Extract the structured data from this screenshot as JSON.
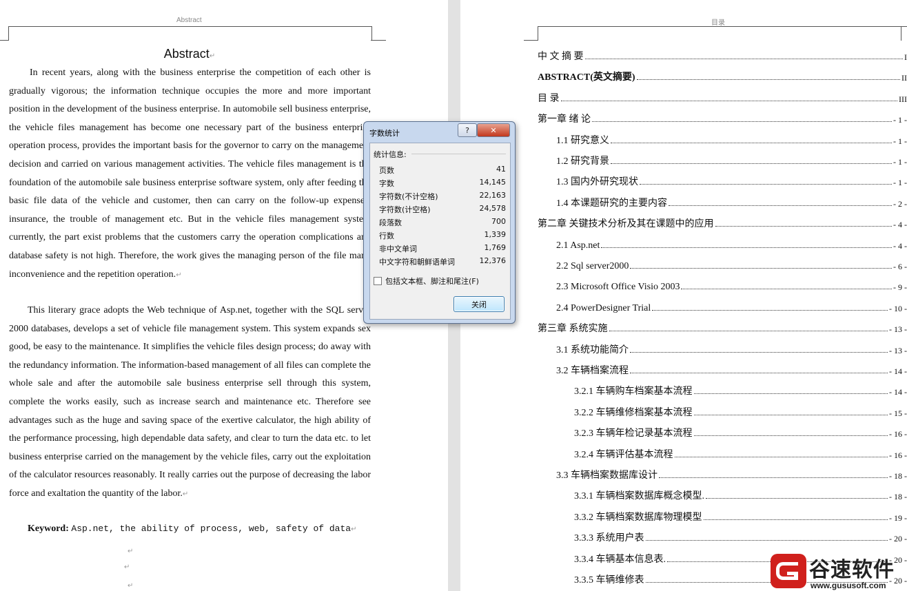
{
  "left_page": {
    "header": "Abstract",
    "title": "Abstract",
    "paragraph1": "In recent years, along with the business enterprise the competition of each other is gradually vigorous; the information technique occupies the more and more important position in the development of the business enterprise. In automobile sell business enterprise, the vehicle files management has become one necessary part of the business enterprise operation process, provides the important basis for the governor to carry on the management decision and carried on various management activities. The vehicle files management is the foundation of the automobile sale business enterprise software system, only after feeding the basic file data of the vehicle and customer, then can carry on the follow-up expenses, insurance, the trouble of management etc. But in the vehicle files management system currently, the part exist problems that the customers carry the operation complications and database safety is not high. Therefore, the work gives the managing person of the file many inconvenience and the repetition operation.",
    "paragraph2": "This literary grace adopts the Web technique of Asp.net, together with the SQL server 2000 databases, develops a set of vehicle file management system. This system expands sex good, be easy to the maintenance. It simplifies the vehicle files design process; do away with the redundancy information. The information-based management of all files can complete the whole sale and after the automobile sale business enterprise sell through this system, complete the works easily, such as increase search and maintenance etc. Therefore see advantages such as the huge and saving space of the exertive calculator, the high ability of the performance processing, high dependable data safety, and clear to turn the data etc. to let business enterprise carried on the management by the vehicle files, carry out the exploitation of the calculator resources reasonably. It really carries out the purpose of decreasing the labor force and exaltation the quantity of the labor.",
    "keyword_label": "Keyword:",
    "keyword_value": "Asp.net, the ability of process, web, safety of data",
    "para_mark": "↵"
  },
  "right_page": {
    "header": "目录",
    "toc": [
      {
        "text": "中  文  摘  要",
        "page": "I",
        "indent": 0,
        "bold": false
      },
      {
        "text": "ABSTRACT(英文摘要)",
        "page": "II",
        "indent": 0,
        "bold": true
      },
      {
        "text": "目        录",
        "page": "III",
        "indent": 0,
        "bold": false
      },
      {
        "text": "第一章   绪   论",
        "page": "- 1 -",
        "indent": 0,
        "bold": false
      },
      {
        "text": "1.1 研究意义",
        "page": "- 1 -",
        "indent": 1,
        "bold": false
      },
      {
        "text": "1.2 研究背景",
        "page": "- 1 -",
        "indent": 1,
        "bold": false
      },
      {
        "text": "1.3 国内外研究现状",
        "page": "- 1 -",
        "indent": 1,
        "bold": false
      },
      {
        "text": "1.4 本课题研究的主要内容",
        "page": "- 2 -",
        "indent": 1,
        "bold": false
      },
      {
        "text": "第二章  关键技术分析及其在课题中的应用",
        "page": "- 4 -",
        "indent": 0,
        "bold": false
      },
      {
        "text": "2.1  Asp.net",
        "page": "- 4 -",
        "indent": 1,
        "bold": false
      },
      {
        "text": "2.2  Sql server2000",
        "page": "- 6 -",
        "indent": 1,
        "bold": false
      },
      {
        "text": "2.3  Microsoft Office Visio  2003",
        "page": "- 9 -",
        "indent": 1,
        "bold": false
      },
      {
        "text": "2.4  PowerDesigner Trial",
        "page": "- 10 -",
        "indent": 1,
        "bold": false
      },
      {
        "text": "第三章   系统实施",
        "page": "- 13 -",
        "indent": 0,
        "bold": false
      },
      {
        "text": "3.1 系统功能简介",
        "page": "- 13 -",
        "indent": 1,
        "bold": false
      },
      {
        "text": "3.2 车辆档案流程",
        "page": "- 14 -",
        "indent": 1,
        "bold": false
      },
      {
        "text": "3.2.1 车辆购车档案基本流程",
        "page": "- 14 -",
        "indent": 2,
        "bold": false
      },
      {
        "text": "3.2.2 车辆维修档案基本流程",
        "page": "- 15 -",
        "indent": 2,
        "bold": false
      },
      {
        "text": "3.2.3 车辆年检记录基本流程",
        "page": "- 16 -",
        "indent": 2,
        "bold": false
      },
      {
        "text": "3.2.4 车辆评估基本流程",
        "page": "- 16 -",
        "indent": 2,
        "bold": false
      },
      {
        "text": "3.3 车辆档案数据库设计",
        "page": "- 18 -",
        "indent": 1,
        "bold": false
      },
      {
        "text": "3.3.1 车辆档案数据库概念模型.",
        "page": "- 18 -",
        "indent": 2,
        "bold": false
      },
      {
        "text": "3.3.2 车辆档案数据库物理模型",
        "page": "- 19 -",
        "indent": 2,
        "bold": false
      },
      {
        "text": "3.3.3 系统用户表",
        "page": "- 20 -",
        "indent": 2,
        "bold": false
      },
      {
        "text": "3.3.4 车辆基本信息表.",
        "page": "- 20 -",
        "indent": 2,
        "bold": false
      },
      {
        "text": "3.3.5 车辆维修表",
        "page": "- 20 -",
        "indent": 2,
        "bold": false
      }
    ]
  },
  "dialog": {
    "title": "字数统计",
    "help_label": "?",
    "close_x_label": "✕",
    "section_label": "统计信息:",
    "stats": [
      {
        "label": "页数",
        "value": "41"
      },
      {
        "label": "字数",
        "value": "14,145"
      },
      {
        "label": "字符数(不计空格)",
        "value": "22,163"
      },
      {
        "label": "字符数(计空格)",
        "value": "24,578"
      },
      {
        "label": "段落数",
        "value": "700"
      },
      {
        "label": "行数",
        "value": "1,339"
      },
      {
        "label": "非中文单词",
        "value": "1,769"
      },
      {
        "label": "中文字符和朝鲜语单词",
        "value": "12,376"
      }
    ],
    "include_label": "包括文本框、脚注和尾注(F)",
    "close_button": "关闭"
  },
  "watermark": {
    "name": "谷速软件",
    "url": "www.gususoft.com",
    "colors": {
      "red": "#d0201c",
      "dark": "#222222"
    }
  }
}
